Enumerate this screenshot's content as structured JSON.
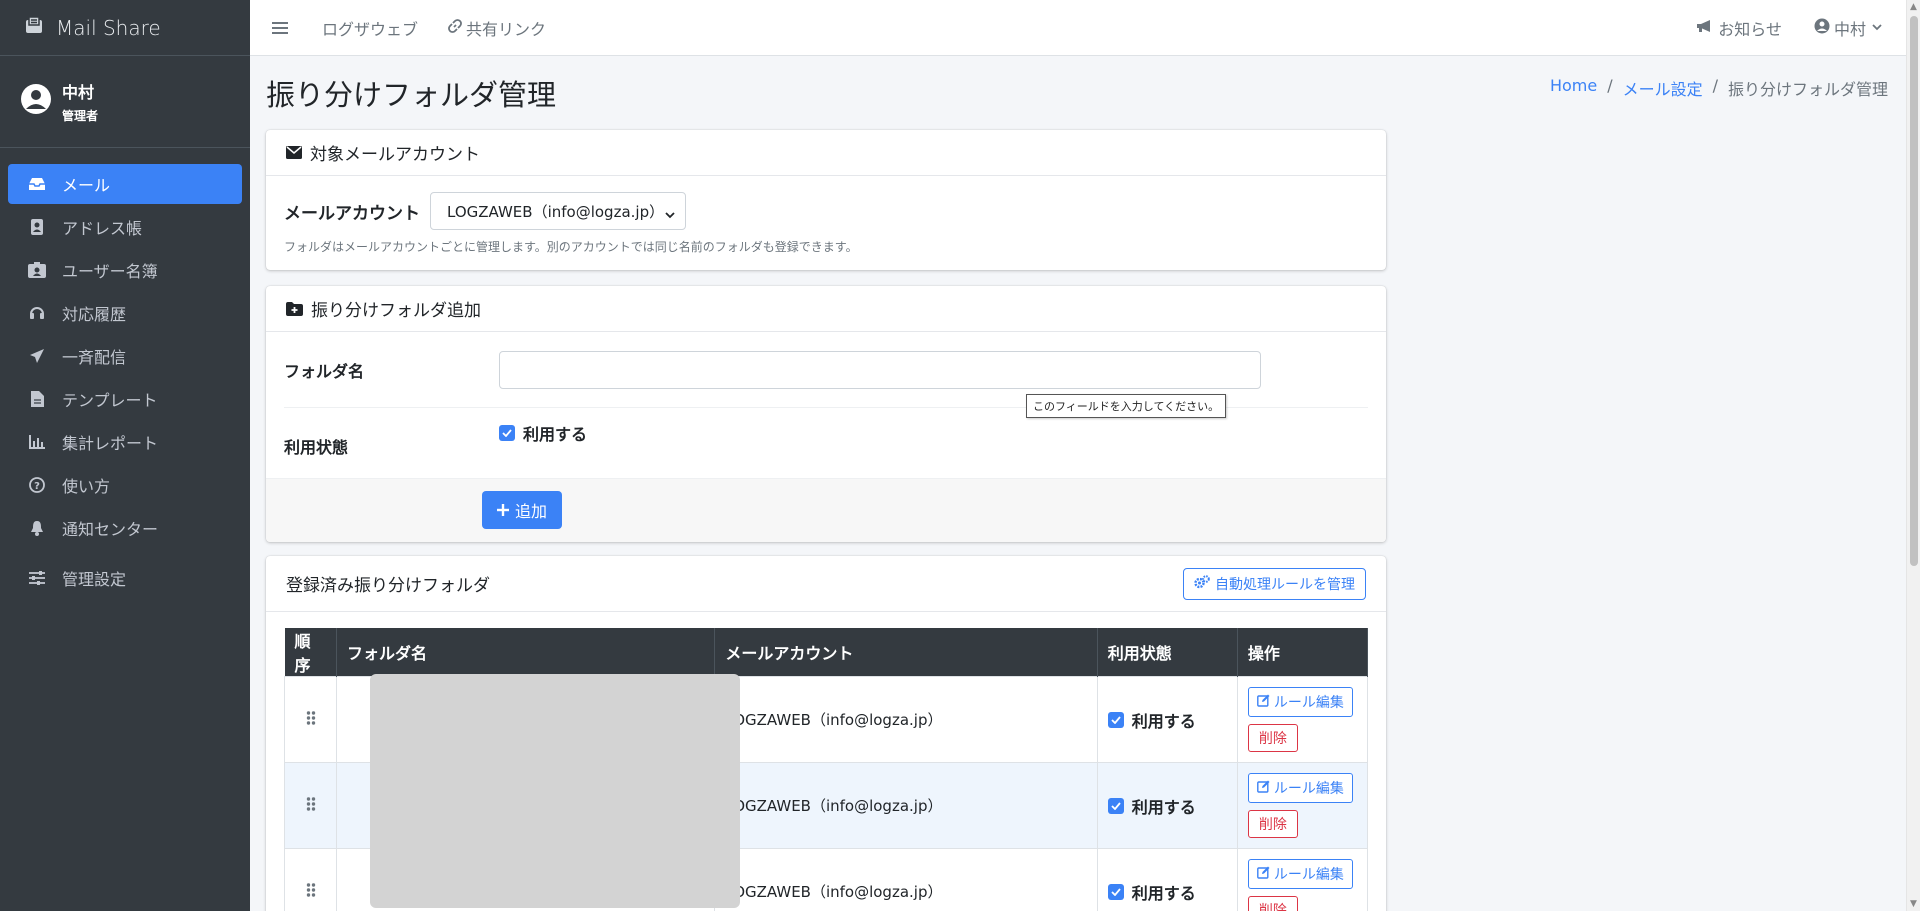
{
  "brand": {
    "name": "Mail Share"
  },
  "user": {
    "name": "中村",
    "role": "管理者"
  },
  "sidebar": {
    "items": [
      {
        "label": "メール",
        "icon": "inbox-icon"
      },
      {
        "label": "アドレス帳",
        "icon": "address-book-icon"
      },
      {
        "label": "ユーザー名簿",
        "icon": "id-badge-icon"
      },
      {
        "label": "対応履歴",
        "icon": "headset-icon"
      },
      {
        "label": "一斉配信",
        "icon": "paper-plane-icon"
      },
      {
        "label": "テンプレート",
        "icon": "file-icon"
      },
      {
        "label": "集計レポート",
        "icon": "chart-icon"
      },
      {
        "label": "使い方",
        "icon": "question-icon"
      },
      {
        "label": "通知センター",
        "icon": "bell-icon"
      },
      {
        "label": "管理設定",
        "icon": "sliders-icon"
      }
    ]
  },
  "topbar": {
    "links": [
      "ログザウェブ",
      "共有リンク"
    ],
    "notice": "お知らせ",
    "user": "中村"
  },
  "page": {
    "title": "振り分けフォルダ管理",
    "breadcrumb": [
      "Home",
      "メール設定",
      "振り分けフォルダ管理"
    ]
  },
  "account_card": {
    "header": "対象メールアカウント",
    "label": "メールアカウント",
    "selected": "LOGZAWEB（info@logza.jp）",
    "help": "フォルダはメールアカウントごとに管理します。別のアカウントでは同じ名前のフォルダも登録できます。"
  },
  "add_card": {
    "header": "振り分けフォルダ追加",
    "folder_label": "フォルダ名",
    "status_label": "利用状態",
    "status_check": "利用する",
    "tooltip": "このフィールドを入力してください。",
    "add_button": "追加"
  },
  "list_card": {
    "header": "登録済み振り分けフォルダ",
    "manage_button": "自動処理ルールを管理",
    "columns": [
      "順序",
      "フォルダ名",
      "メールアカウント",
      "利用状態",
      "操作"
    ],
    "rows": [
      {
        "account": "LOGZAWEB（info@logza.jp）",
        "status": "利用する",
        "edit": "ルール編集",
        "delete": "削除"
      },
      {
        "account": "LOGZAWEB（info@logza.jp）",
        "status": "利用する",
        "edit": "ルール編集",
        "delete": "削除"
      },
      {
        "account": "LOGZAWEB（info@logza.jp）",
        "status": "利用する",
        "edit": "ルール編集",
        "delete": "削除"
      }
    ]
  },
  "colors": {
    "primary": "#3b82f6",
    "sidebar": "#343a40",
    "danger": "#dc3545"
  }
}
